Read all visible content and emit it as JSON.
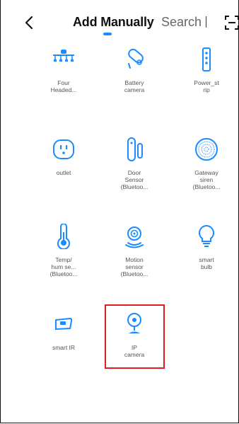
{
  "header": {
    "tab_add": "Add Manually",
    "tab_search": "Search",
    "back_icon": "chevron-left-icon",
    "scan_icon": "scan-icon"
  },
  "devices": [
    {
      "lines": [
        "Four",
        "Headed..."
      ],
      "icon": "four-headed-light-icon"
    },
    {
      "lines": [
        "Battery",
        "camera"
      ],
      "icon": "battery-camera-icon"
    },
    {
      "lines": [
        "Power_st",
        "rip"
      ],
      "icon": "power-strip-icon"
    },
    {
      "lines": [
        "outlet"
      ],
      "icon": "outlet-icon"
    },
    {
      "lines": [
        "Door",
        "Sensor",
        "(Bluetoo..."
      ],
      "icon": "door-sensor-icon"
    },
    {
      "lines": [
        "Gateway",
        "siren",
        "(Bluetoo..."
      ],
      "icon": "gateway-siren-icon"
    },
    {
      "lines": [
        "Temp/",
        "hum se...",
        "(Bluetoo..."
      ],
      "icon": "thermometer-icon"
    },
    {
      "lines": [
        "Motion",
        "sensor",
        "(Bluetoo..."
      ],
      "icon": "motion-sensor-icon"
    },
    {
      "lines": [
        "smart",
        "bulb"
      ],
      "icon": "bulb-icon"
    },
    {
      "lines": [
        "smart IR"
      ],
      "icon": "smart-ir-icon"
    },
    {
      "lines": [
        "IP",
        "camera"
      ],
      "icon": "ip-camera-icon"
    }
  ],
  "colors": {
    "accent": "#1a8cff",
    "icon": "#1a8cff",
    "highlight": "#e01e22"
  }
}
